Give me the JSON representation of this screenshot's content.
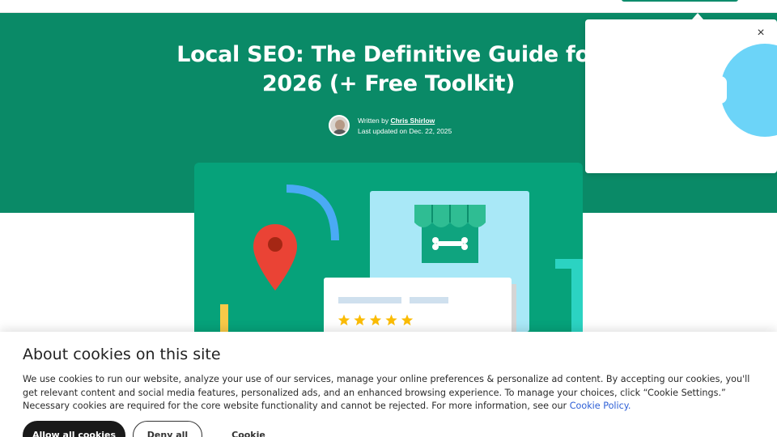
{
  "article": {
    "title": "Local SEO: The Definitive Guide for 2026 (+ Free Toolkit)",
    "byline_prefix": "Written by ",
    "author": "Chris Shirlow",
    "updated": "Last updated on Dec. 22, 2025"
  },
  "popup": {
    "close_icon": "×"
  },
  "cookie_banner": {
    "title": "About cookies on this site",
    "body": "We use cookies to run our website, analyze your use of our services, manage your online preferences & personalize ad content. By accepting our cookies, you'll get relevant content and social media features, personalized ads, and an enhanced browsing experience. To manage your choices, click “Cookie Settings.” Necessary cookies are required for the core website functionality and cannot be rejected. For more information, see our ",
    "policy_link": "Cookie Policy.",
    "allow_label": "Allow all cookies",
    "deny_label": "Deny all",
    "settings_label": "Cookie settings"
  },
  "colors": {
    "hero_green": "#0a8a67",
    "illustration_green": "#06a27a",
    "pin_red": "#ea4335",
    "star_yellow": "#fbbc04",
    "sky_blue": "#6cd4f8"
  },
  "illustration": {
    "stars": 5
  }
}
